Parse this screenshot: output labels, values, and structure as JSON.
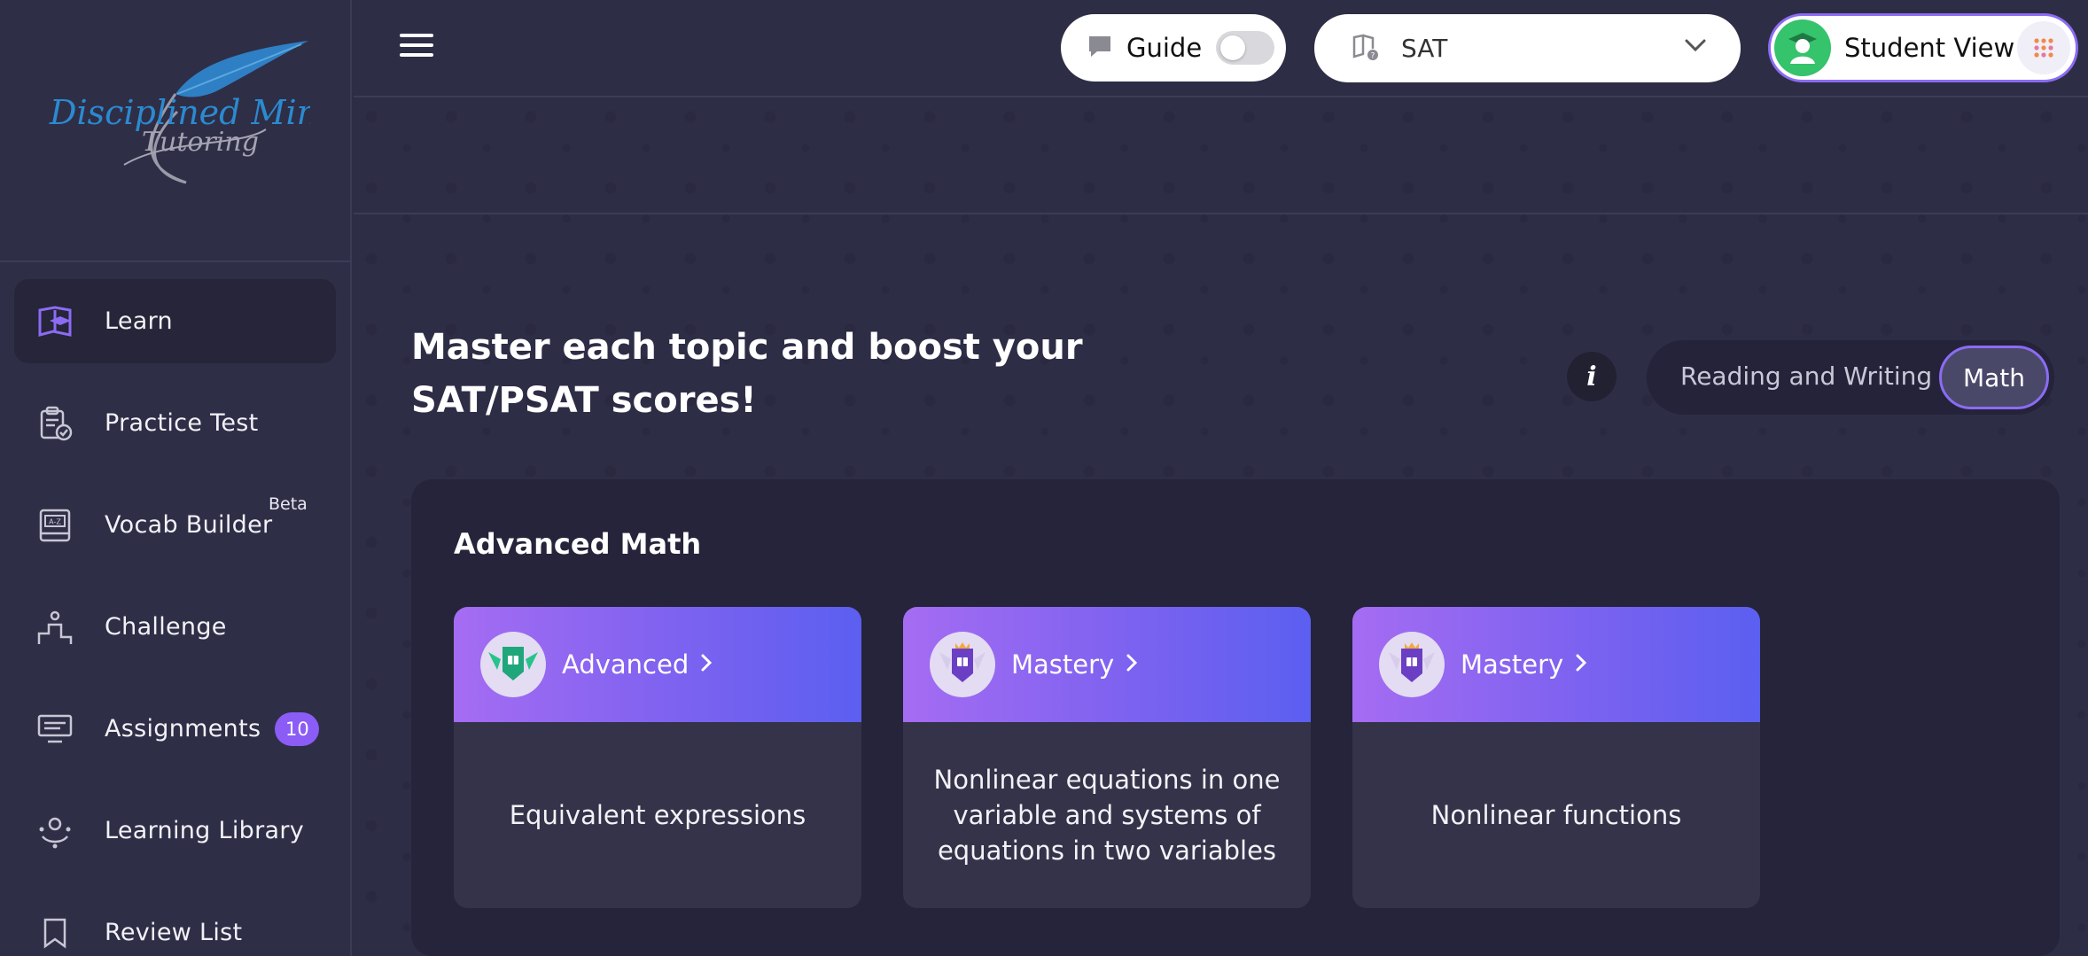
{
  "sidebar": {
    "logo": {
      "line1": "Disciplined Minds",
      "line2": "Tutoring"
    },
    "items": [
      {
        "label": "Learn",
        "icon": "learn-book-icon",
        "active": true
      },
      {
        "label": "Practice Test",
        "icon": "clipboard-check-icon"
      },
      {
        "label": "Vocab Builder",
        "icon": "vocab-book-icon",
        "tag": "Beta"
      },
      {
        "label": "Challenge",
        "icon": "podium-icon"
      },
      {
        "label": "Assignments",
        "icon": "keyboard-icon",
        "count": "10"
      },
      {
        "label": "Learning Library",
        "icon": "library-icon"
      },
      {
        "label": "Review List",
        "icon": "bookmark-icon"
      }
    ]
  },
  "header": {
    "guide": {
      "label": "Guide",
      "enabled": false
    },
    "exam_select": {
      "value": "SAT"
    },
    "student_view": {
      "label": "Student View"
    }
  },
  "main": {
    "headline": "Master each topic and boost your SAT/PSAT scores!",
    "subject_toggle": {
      "options": [
        "Reading and Writing",
        "Math"
      ],
      "selected": "Math"
    },
    "section": {
      "title": "Advanced Math",
      "cards": [
        {
          "level": "Advanced",
          "topic": "Equivalent expressions",
          "badge_color": "#1fa67a"
        },
        {
          "level": "Mastery",
          "topic": "Nonlinear equations in one variable and systems of equations in two variables",
          "badge_color": "#6b3fc4"
        },
        {
          "level": "Mastery",
          "topic": "Nonlinear functions",
          "badge_color": "#6b3fc4"
        }
      ]
    }
  },
  "colors": {
    "accent": "#8b6cf3",
    "badge": "#8b5cf6",
    "background": "#2e2d46",
    "panel": "#25243a"
  }
}
